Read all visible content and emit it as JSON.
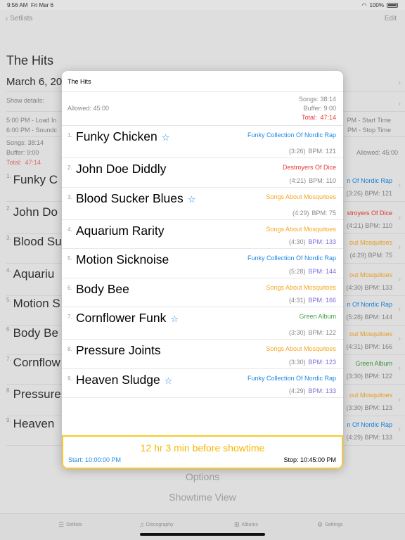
{
  "status": {
    "time": "9:56 AM",
    "date": "Fri Mar 6",
    "battery": "100%"
  },
  "nav": {
    "back_label": "Setlists",
    "edit_label": "Edit"
  },
  "background": {
    "title": "The Hits",
    "date": "March 6, 20",
    "show_details_label": "Show details:",
    "load_in": "5:00 PM - Load In",
    "soundcheck": "6:00 PM - Soundc",
    "start_time": "PM - Start Time",
    "stop_time": "PM - Stop Time",
    "songs_label": "Songs:   38:14",
    "buffer_label": "Buffer:   9:00",
    "total_label": "Total:",
    "total_value": "47:14",
    "allowed_label": "Allowed:   45:00",
    "rows": [
      {
        "n": "1.",
        "title": "Funky C",
        "album": "n Of Nordic Rap",
        "meta": "(3:26)  BPM: 121"
      },
      {
        "n": "2.",
        "title": "John Do",
        "album": "stroyers Of Dice",
        "meta": "(4:21)  BPM: 110"
      },
      {
        "n": "3.",
        "title": "Blood Su",
        "album": "out Mosquitoes",
        "meta": "(4:29)  BPM: 75"
      },
      {
        "n": "4.",
        "title": "Aquariu",
        "album": "out Mosquitoes",
        "meta": "(4:30)  BPM: 133"
      },
      {
        "n": "5.",
        "title": "Motion S",
        "album": "n Of Nordic Rap",
        "meta": "(5:28)  BPM: 144"
      },
      {
        "n": "6.",
        "title": "Body Be",
        "album": "out Mosquitoes",
        "meta": "(4:31)  BPM: 166"
      },
      {
        "n": "7.",
        "title": "Cornflow",
        "album": "Green   Album",
        "meta": "(3:30)  BPM: 122"
      },
      {
        "n": "8.",
        "title": "Pressure",
        "album": "out Mosquitoes",
        "meta": "(3:30)  BPM: 123"
      },
      {
        "n": "9.",
        "title": "Heaven",
        "album": "n Of Nordic Rap",
        "meta": "(4:29)  BPM: 133"
      }
    ],
    "options_label": "Options",
    "showtime_view_label": "Showtime View"
  },
  "tabs": [
    {
      "label": "Setlists",
      "icon": "list-icon"
    },
    {
      "label": "Discography",
      "icon": "music-note-icon"
    },
    {
      "label": "Albums",
      "icon": "grid-icon"
    },
    {
      "label": "Settings",
      "icon": "gear-icon"
    }
  ],
  "modal": {
    "title": "The Hits",
    "allowed": "Allowed:   45:00",
    "songs": "Songs:   38:14",
    "buffer": "Buffer:   9:00",
    "total_label": "Total:",
    "total_value": "47:14",
    "songs_list": [
      {
        "n": "1.",
        "title": "Funky Chicken",
        "star": "☆",
        "album": "Funky Collection Of Nordic Rap",
        "album_color": "#1e88e5",
        "duration": "(3:26)",
        "bpm": "BPM: 121",
        "bpm_color": "#888888"
      },
      {
        "n": "2.",
        "title": "John Doe Diddly",
        "star": "",
        "album": "Destroyers Of Dice",
        "album_color": "#e53935",
        "duration": "(4:21)",
        "bpm": "BPM: 110",
        "bpm_color": "#888888"
      },
      {
        "n": "3.",
        "title": "Blood Sucker Blues",
        "star": "☆",
        "album": "Songs About Mosquitoes",
        "album_color": "#f5a623",
        "duration": "(4:29)",
        "bpm": "BPM: 75",
        "bpm_color": "#888888"
      },
      {
        "n": "4.",
        "title": "Aquarium Rarity",
        "star": "",
        "album": "Songs About Mosquitoes",
        "album_color": "#f5a623",
        "duration": "(4:30)",
        "bpm": "BPM: 133",
        "bpm_color": "#7e6fd8"
      },
      {
        "n": "5.",
        "title": "Motion Sicknoise",
        "star": "",
        "album": "Funky Collection Of Nordic Rap",
        "album_color": "#1e88e5",
        "duration": "(5:28)",
        "bpm": "BPM: 144",
        "bpm_color": "#7e6fd8"
      },
      {
        "n": "6.",
        "title": "Body Bee",
        "star": "",
        "album": "Songs About Mosquitoes",
        "album_color": "#f5a623",
        "duration": "(4:31)",
        "bpm": "BPM: 166",
        "bpm_color": "#7e6fd8"
      },
      {
        "n": "7.",
        "title": "Cornflower Funk",
        "star": "☆",
        "album": "Green   Album",
        "album_color": "#43a047",
        "duration": "(3:30)",
        "bpm": "BPM: 122",
        "bpm_color": "#888888"
      },
      {
        "n": "8.",
        "title": "Pressure Joints",
        "star": "",
        "album": "Songs About Mosquitoes",
        "album_color": "#f5a623",
        "duration": "(3:30)",
        "bpm": "BPM: 123",
        "bpm_color": "#7e6fd8"
      },
      {
        "n": "9.",
        "title": "Heaven Sludge",
        "star": "☆",
        "album": "Funky Collection Of Nordic Rap",
        "album_color": "#1e88e5",
        "duration": "(4:29)",
        "bpm": "BPM: 133",
        "bpm_color": "#7e6fd8"
      }
    ],
    "countdown": "12 hr 3 min before showtime",
    "start": "Start: 10:00:00 PM",
    "stop": "Stop: 10:45:00 PM",
    "accent_color": "#f7c928"
  }
}
